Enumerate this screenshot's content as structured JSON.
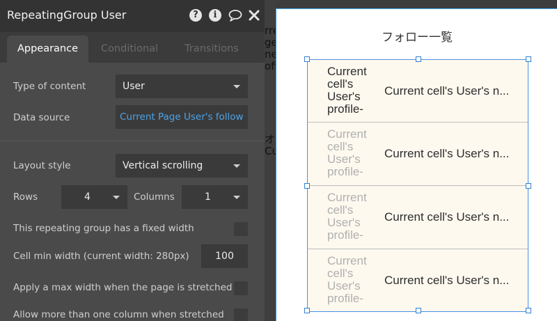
{
  "panel": {
    "title": "RepeatingGroup User",
    "header_icons": [
      "help-icon",
      "info-icon",
      "comment-icon",
      "close-icon"
    ],
    "help_glyph": "?",
    "info_glyph": "i",
    "tabs": [
      {
        "label": "Appearance",
        "active": true
      },
      {
        "label": "Conditional",
        "active": false
      },
      {
        "label": "Transitions",
        "active": false
      }
    ],
    "type_of_content": {
      "label": "Type of content",
      "value": "User"
    },
    "data_source": {
      "label": "Data source",
      "value": "Current Page User's follow"
    },
    "layout_style": {
      "label": "Layout style",
      "value": "Vertical scrolling"
    },
    "rows": {
      "label": "Rows",
      "value": "4"
    },
    "columns": {
      "label": "Columns",
      "value": "1"
    },
    "fixed_width": {
      "label": "This repeating group has a fixed width",
      "checked": false
    },
    "cell_min_width": {
      "label": "Cell min width (current width: 280px)",
      "value": "100"
    },
    "max_width": {
      "label": "Apply a max width when the page is stretched",
      "checked": false
    },
    "multi_column": {
      "label": "Allow more than one column when stretched",
      "checked": false
    }
  },
  "background_fragments": [
    "rre",
    "ge",
    "ne",
    "ofil",
    "オ",
    "Cu"
  ],
  "canvas": {
    "title": "フォロー一覧",
    "cells": [
      {
        "image_text": "Current\ncell's\nUser's\nprofile-",
        "name_text": "Current cell's User's n...",
        "image_text_color": "#2d2d2d"
      },
      {
        "image_text": "Current\ncell's\nUser's\nprofile-",
        "name_text": "Current cell's User's n...",
        "image_text_color": "#b0b0b0"
      },
      {
        "image_text": "Current\ncell's\nUser's\nprofile-",
        "name_text": "Current cell's User's n...",
        "image_text_color": "#b0b0b0"
      },
      {
        "image_text": "Current\ncell's\nUser's\nprofile-",
        "name_text": "Current cell's User's n...",
        "image_text_color": "#b0b0b0"
      }
    ]
  },
  "colors": {
    "panel_bg": "#4a4a4a",
    "header_bg": "#333333",
    "accent_link": "#4da3e6",
    "selection_blue": "#2f80d1",
    "cell_bg": "#fdf9ef"
  }
}
